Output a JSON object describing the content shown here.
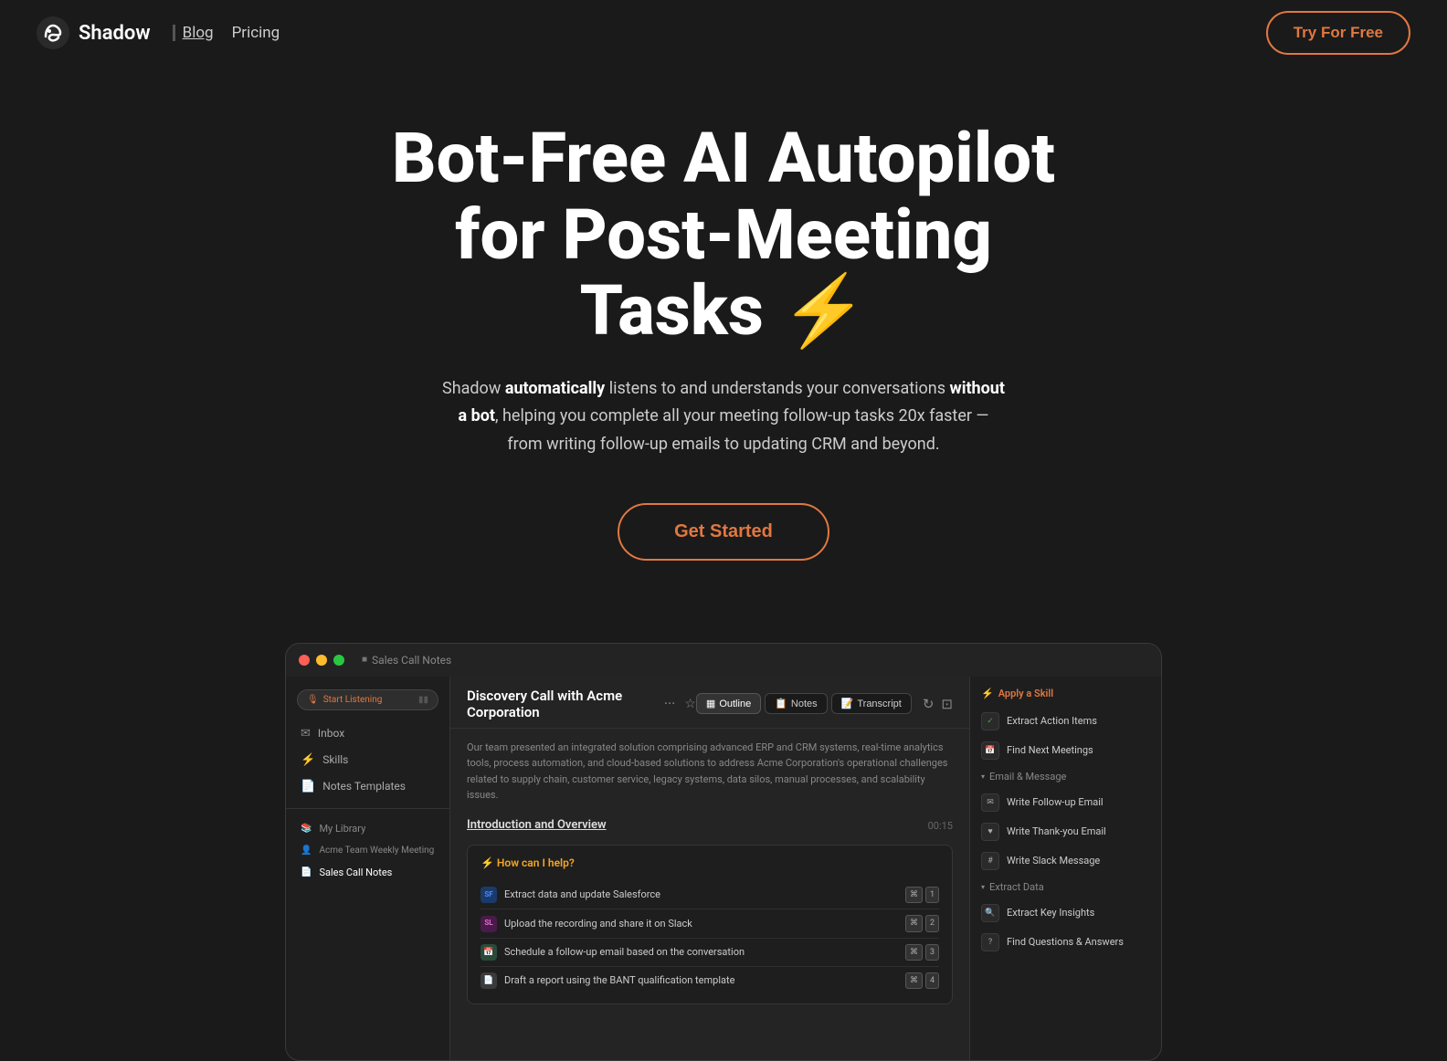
{
  "nav": {
    "logo_text": "Shadow",
    "blog_label": "Blog",
    "pricing_label": "Pricing",
    "try_btn_label": "Try For Free"
  },
  "hero": {
    "title_line1": "Bot-Free AI Autopilot",
    "title_line2": "for Post-Meeting",
    "title_line3": "Tasks",
    "lightning_emoji": "⚡",
    "subtitle_part1": "Shadow ",
    "subtitle_bold1": "automatically",
    "subtitle_part2": " listens to and understands your conversations ",
    "subtitle_bold2": "without a bot",
    "subtitle_part3": ", helping you complete all your meeting follow-up tasks 20x faster — from writing follow-up emails to updating CRM and beyond.",
    "get_started_label": "Get Started"
  },
  "app": {
    "titlebar_tab": "Sales Call Notes",
    "meeting_title": "Discovery Call with Acme Corporation",
    "tabs": {
      "outline": "Outline",
      "notes": "Notes",
      "transcript": "Transcript"
    },
    "intro_text": "Our team presented an integrated solution comprising advanced ERP and CRM systems, real-time analytics tools, process automation, and cloud-based solutions to address Acme Corporation's operational challenges related to supply chain, customer service, legacy systems, data silos, manual processes, and scalability issues.",
    "section_title": "Introduction and Overview",
    "section_time": "00:15",
    "help_title": "⚡ How can I help?",
    "tasks": [
      {
        "label": "Extract data and update Salesforce",
        "app": "SF",
        "key": "1",
        "app_type": "sf"
      },
      {
        "label": "Upload the recording and share it on Slack",
        "app": "SL",
        "key": "2",
        "app_type": "slack"
      },
      {
        "label": "Schedule a follow-up email based on the conversation",
        "app": "📅",
        "key": "3",
        "app_type": "cal"
      },
      {
        "label": "Draft a report using the BANT qualification template",
        "app": "📄",
        "key": "4",
        "app_type": "doc"
      }
    ],
    "sidebar": {
      "listen_btn": "Start Listening",
      "items": [
        {
          "label": "Inbox",
          "icon": "✉"
        },
        {
          "label": "Skills",
          "icon": "⚡"
        },
        {
          "label": "Notes Templates",
          "icon": "📄"
        }
      ],
      "sub_items": [
        {
          "label": "My Library",
          "icon": "📚"
        },
        {
          "label": "Acme Team Weekly Meeting",
          "icon": "👤"
        },
        {
          "label": "Sales Call Notes",
          "icon": "📄"
        }
      ]
    },
    "right_panel": {
      "apply_skill_label": "Apply a Skill",
      "extract_action": "Extract Action Items",
      "find_next": "Find Next Meetings",
      "email_group": "Email & Message",
      "write_followup": "Write Follow-up Email",
      "write_thankyou": "Write Thank-you Email",
      "write_slack": "Write Slack Message",
      "extract_data_group": "Extract Data",
      "extract_key": "Extract Key Insights",
      "find_questions": "Find Questions & Answers"
    }
  }
}
